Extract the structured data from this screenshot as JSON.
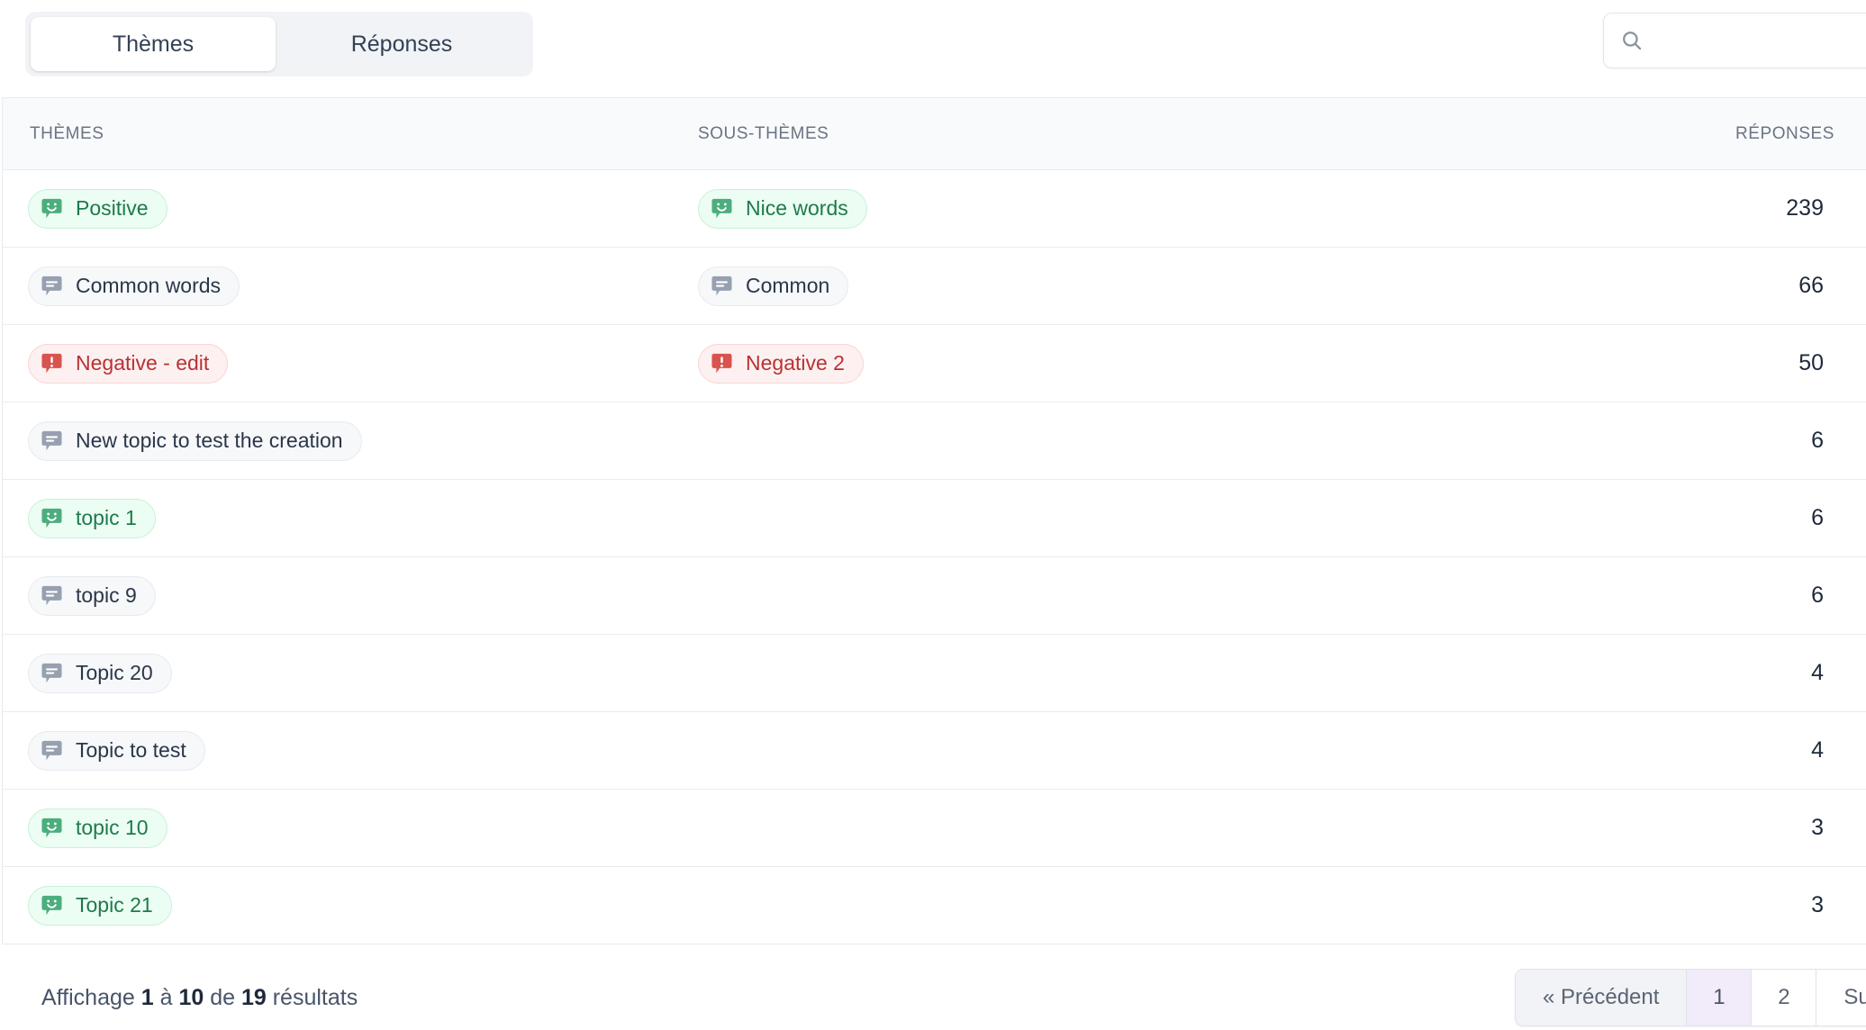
{
  "tabs": [
    {
      "label": "Thèmes",
      "active": true
    },
    {
      "label": "Réponses",
      "active": false
    }
  ],
  "search": {
    "value": "",
    "placeholder": "",
    "icon": "search-icon"
  },
  "table": {
    "columns": {
      "theme": "THÈMES",
      "subtheme": "SOUS-THÈMES",
      "count": "RÉPONSES"
    },
    "rows": [
      {
        "theme": {
          "label": "Positive",
          "tone": "green",
          "icon": "smiley-bubble-icon"
        },
        "subtheme": {
          "label": "Nice words",
          "tone": "green",
          "icon": "smiley-bubble-icon"
        },
        "count": "239"
      },
      {
        "theme": {
          "label": "Common words",
          "tone": "grey",
          "icon": "lines-bubble-icon"
        },
        "subtheme": {
          "label": "Common",
          "tone": "grey",
          "icon": "lines-bubble-icon"
        },
        "count": "66"
      },
      {
        "theme": {
          "label": "Negative - edit",
          "tone": "red",
          "icon": "alert-bubble-icon"
        },
        "subtheme": {
          "label": "Negative 2",
          "tone": "red",
          "icon": "alert-bubble-icon"
        },
        "count": "50"
      },
      {
        "theme": {
          "label": "New topic to test the creation",
          "tone": "grey",
          "icon": "lines-bubble-icon"
        },
        "subtheme": null,
        "count": "6"
      },
      {
        "theme": {
          "label": "topic 1",
          "tone": "green",
          "icon": "smiley-bubble-icon"
        },
        "subtheme": null,
        "count": "6"
      },
      {
        "theme": {
          "label": "topic 9",
          "tone": "grey",
          "icon": "lines-bubble-icon"
        },
        "subtheme": null,
        "count": "6"
      },
      {
        "theme": {
          "label": "Topic 20",
          "tone": "grey",
          "icon": "lines-bubble-icon"
        },
        "subtheme": null,
        "count": "4"
      },
      {
        "theme": {
          "label": "Topic to test",
          "tone": "grey",
          "icon": "lines-bubble-icon"
        },
        "subtheme": null,
        "count": "4"
      },
      {
        "theme": {
          "label": "topic 10",
          "tone": "green",
          "icon": "smiley-bubble-icon"
        },
        "subtheme": null,
        "count": "3"
      },
      {
        "theme": {
          "label": "Topic 21",
          "tone": "green",
          "icon": "smiley-bubble-icon"
        },
        "subtheme": null,
        "count": "3"
      }
    ]
  },
  "footer": {
    "info_prefix": "Affichage ",
    "info_from": "1",
    "info_mid1": " à ",
    "info_to": "10",
    "info_mid2": " de ",
    "info_total": "19",
    "info_suffix": " résultats",
    "pagination": {
      "previous": "« Précédent",
      "pages": [
        "1",
        "2"
      ],
      "active_page": "1",
      "next": "Suivant »"
    }
  },
  "colors": {
    "green_bg": "#ecfdf3",
    "green_border": "#c7f0d8",
    "green_text": "#1d7a4b",
    "green_icon": "#4cae7e",
    "grey_bg": "#f6f8fa",
    "grey_border": "#e6eaef",
    "grey_text": "#2b3648",
    "grey_icon": "#97a0b0",
    "red_bg": "#fdf0f0",
    "red_border": "#f8d4d4",
    "red_text": "#b83232",
    "red_icon": "#d9534f",
    "active_page_bg": "#f1ebfa",
    "header_bg": "#f8fafc",
    "tabgroup_bg": "#f1f3f6",
    "border": "#e8ebef"
  }
}
